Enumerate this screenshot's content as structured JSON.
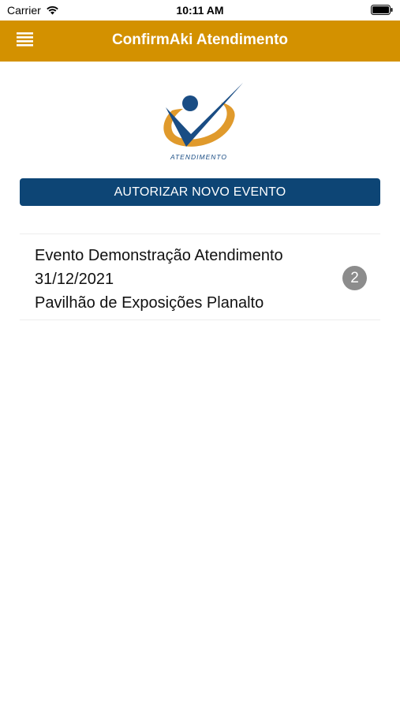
{
  "status_bar": {
    "carrier": "Carrier",
    "time": "10:11 AM",
    "icons": [
      "wifi-icon",
      "battery-icon"
    ]
  },
  "nav_bar": {
    "title": "ConfirmAki Atendimento",
    "menu_icon": "hamburger-menu-icon",
    "background_color": "#d39100"
  },
  "logo": {
    "text": "ATENDIMENTO",
    "colors": {
      "orange": "#e09a2c",
      "blue": "#1a4d84"
    }
  },
  "authorize_button": {
    "label": "AUTORIZAR NOVO EVENTO",
    "color": "#0d4575"
  },
  "events": [
    {
      "name": "Evento Demonstração Atendimento",
      "date": "31/12/2021",
      "location": "Pavilhão de Exposições Planalto",
      "badge": "2"
    }
  ]
}
